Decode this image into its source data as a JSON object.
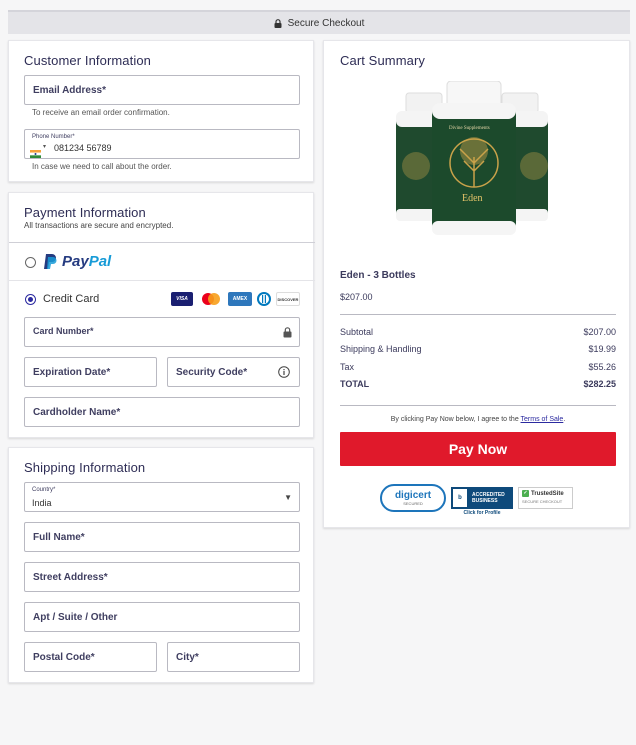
{
  "topbar": {
    "title": "Secure Checkout"
  },
  "customer": {
    "heading": "Customer Information",
    "email_label": "Email Address*",
    "email_hint": "To receive an email order confirmation.",
    "phone_label": "Phone Number*",
    "phone_value": "081234 56789",
    "phone_hint": "In case we need to call about the order."
  },
  "payment": {
    "heading": "Payment Information",
    "subheading": "All transactions are secure and encrypted.",
    "paypal_label_pay": "Pay",
    "paypal_label_pal": "Pal",
    "credit_card_label": "Credit Card",
    "card_brands": [
      "VISA",
      "mastercard",
      "AMEX",
      "diners",
      "DISCOVER"
    ],
    "card_number_label": "Card Number*",
    "expiration_label": "Expiration Date*",
    "security_label": "Security Code*",
    "cardholder_label": "Cardholder Name*"
  },
  "shipping": {
    "heading": "Shipping Information",
    "country_label": "Country*",
    "country_value": "India",
    "full_name_label": "Full Name*",
    "street_label": "Street Address*",
    "apt_label": "Apt / Suite / Other",
    "postal_label": "Postal Code*",
    "city_label": "City*"
  },
  "cart": {
    "heading": "Cart Summary",
    "product_brand": "Divine Supplements",
    "product_bottle_name": "Eden",
    "product_name": "Eden - 3 Bottles",
    "product_price": "$207.00",
    "rows": [
      {
        "label": "Subtotal",
        "value": "$207.00"
      },
      {
        "label": "Shipping & Handling",
        "value": "$19.99"
      },
      {
        "label": "Tax",
        "value": "$55.26"
      },
      {
        "label": "TOTAL",
        "value": "$282.25"
      }
    ],
    "terms_prefix": "By clicking Pay Now below, I agree to the ",
    "terms_link": "Terms of Sale",
    "terms_suffix": ".",
    "pay_button": "Pay Now",
    "badges": {
      "digicert": "digicert",
      "digicert_sub": "SECURED",
      "bbb_line1": "ACCREDITED",
      "bbb_line2": "BUSINESS",
      "bbb_sub": "Click for Profile",
      "trusted": "TrustedSite",
      "trusted_sub": "SECURE CHECKOUT"
    }
  },
  "colors": {
    "accent": "#2e2d55",
    "pay_button": "#e0192b",
    "paypal_dark": "#253b80",
    "paypal_light": "#179bd7"
  }
}
